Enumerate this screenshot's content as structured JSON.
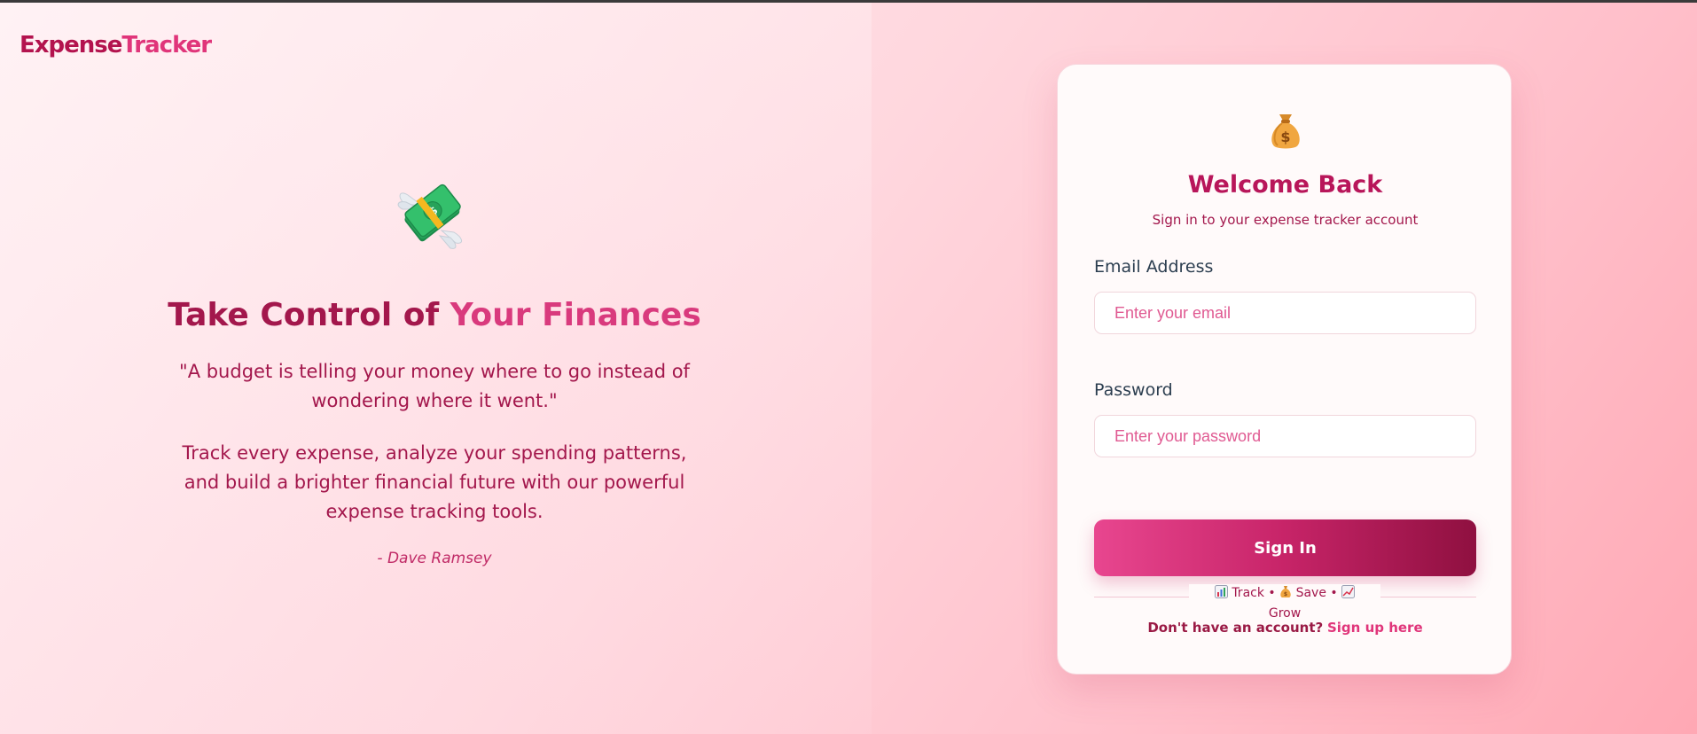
{
  "brand": {
    "part1": "Expense",
    "part2": "Tracker"
  },
  "hero": {
    "icon": "money-with-wings-icon",
    "title_main": "Take Control of ",
    "title_accent": "Your Finances",
    "quote": "\"A budget is telling your money where to go instead of wondering where it went.\"",
    "description": "Track every expense, analyze your spending patterns, and build a brighter financial future with our powerful expense tracking tools.",
    "author": "- Dave Ramsey"
  },
  "login": {
    "icon": "money-bag-icon",
    "title": "Welcome Back",
    "subtitle": "Sign in to your expense tracker account",
    "email_label": "Email Address",
    "email_placeholder": "Enter your email",
    "email_value": "",
    "password_label": "Password",
    "password_placeholder": "Enter your password",
    "password_value": "",
    "signin_label": "Sign In",
    "tagline": {
      "track": "Track",
      "save": "Save",
      "grow": "Grow",
      "separator": "•",
      "icons": [
        "bar-chart-icon",
        "money-bag-icon",
        "trend-up-icon"
      ]
    },
    "signup_prompt": "Don't have an account?",
    "signup_link": "Sign up here"
  },
  "colors": {
    "primary": "#b8165a",
    "accent": "#e0357a",
    "text_dark": "#a3174c",
    "button_start": "#e8468f",
    "button_end": "#8f1040"
  }
}
